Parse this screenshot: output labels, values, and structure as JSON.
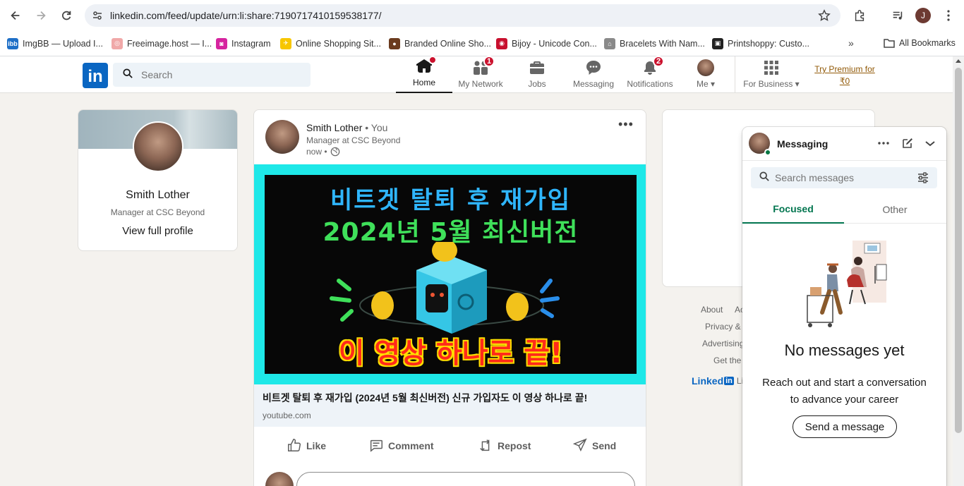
{
  "browser": {
    "url": "linkedin.com/feed/update/urn:li:share:7190717410159538177/",
    "profile_initial": "J",
    "bookmarks": [
      {
        "label": "ImgBB — Upload I...",
        "color": "#1e6fc7",
        "glyph": "ibb"
      },
      {
        "label": "Freeimage.host — I...",
        "color": "#f0a8a8",
        "glyph": "◎"
      },
      {
        "label": "Instagram",
        "color": "#d6249f",
        "glyph": "◙"
      },
      {
        "label": "Online Shopping Sit...",
        "color": "#f7c600",
        "glyph": "✈"
      },
      {
        "label": "Branded Online Sho...",
        "color": "#6b3b1e",
        "glyph": "●"
      },
      {
        "label": "Bijoy - Unicode Con...",
        "color": "#c8102e",
        "glyph": "◉"
      },
      {
        "label": "Bracelets With Nam...",
        "color": "#8a8a8a",
        "glyph": "⌂"
      },
      {
        "label": "Printshoppy: Custo...",
        "color": "#222222",
        "glyph": "▣"
      }
    ],
    "more_bookmarks": "»",
    "all_bookmarks": "All Bookmarks"
  },
  "header": {
    "search_placeholder": "Search",
    "nav": [
      {
        "label": "Home",
        "badge": "",
        "dot": true
      },
      {
        "label": "My Network",
        "badge": "1"
      },
      {
        "label": "Jobs",
        "badge": ""
      },
      {
        "label": "Messaging",
        "badge": ""
      },
      {
        "label": "Notifications",
        "badge": "2"
      },
      {
        "label": "Me",
        "badge": ""
      },
      {
        "label": "For Business",
        "badge": ""
      }
    ],
    "premium_line1": "Try Premium for",
    "premium_line2": "₹0"
  },
  "profile": {
    "name": "Smith Lother",
    "headline": "Manager at CSC Beyond",
    "view_profile": "View full profile"
  },
  "post": {
    "author": "Smith Lother",
    "author_suffix": " • You",
    "headline": "Manager at CSC Beyond",
    "time": "now •",
    "thumb_line1": "비트겟 탈퇴 후 재가입",
    "thumb_line2": "2024년 5월 최신버전",
    "thumb_line3": "이 영상 하나로 끝!",
    "link_title": "비트겟 탈퇴 후 재가입 (2024년 5월 최신버전) 신규 가입자도 이 영상 하나로 끝!",
    "link_source": "youtube.com",
    "actions": {
      "like": "Like",
      "comment": "Comment",
      "repost": "Repost",
      "send": "Send"
    }
  },
  "footer": {
    "links": [
      "About",
      "Ac",
      "Privacy &",
      "Advertising",
      "Get the"
    ],
    "brand": "Linked",
    "brand_in": "in",
    "brand_tail": "Li"
  },
  "messaging": {
    "title": "Messaging",
    "search_placeholder": "Search messages",
    "tabs": [
      "Focused",
      "Other"
    ],
    "empty_title": "No messages yet",
    "empty_sub": "Reach out and start a conversation to advance your career",
    "send_button": "Send a message"
  },
  "colors": {
    "linkedin_blue": "#0a66c2",
    "focused_green": "#01754f",
    "badge_red": "#cb112d",
    "thumbnail_cyan": "#1ee8e8"
  }
}
